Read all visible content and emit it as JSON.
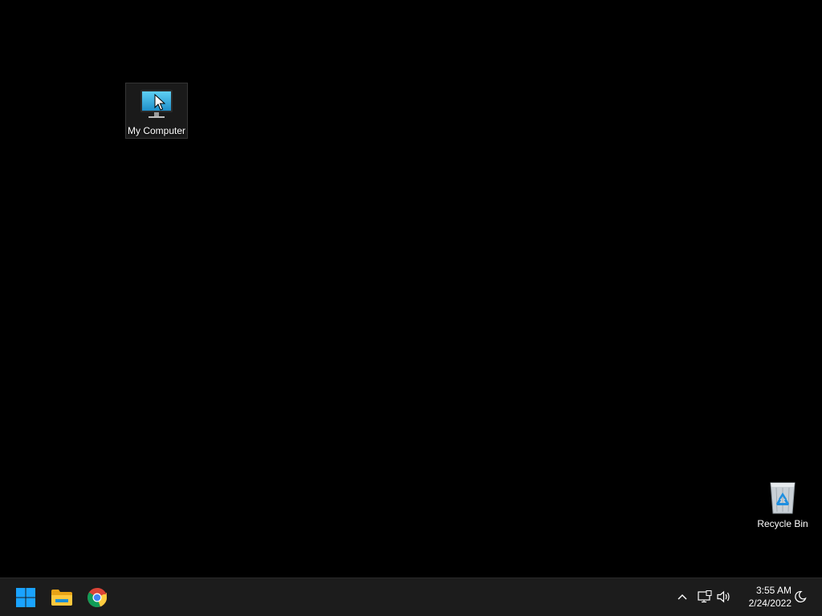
{
  "desktop": {
    "icons": [
      {
        "label": "My Computer",
        "icon": "monitor-icon",
        "selected": true
      },
      {
        "label": "Recycle Bin",
        "icon": "recycle-bin-icon",
        "selected": false
      }
    ]
  },
  "taskbar": {
    "pinned": [
      {
        "name": "Start",
        "icon": "windows-logo-icon"
      },
      {
        "name": "File Explorer",
        "icon": "folder-icon"
      },
      {
        "name": "Google Chrome",
        "icon": "chrome-icon"
      }
    ],
    "tray": {
      "icons": [
        "chevron-up-icon",
        "network-icon",
        "volume-icon",
        "focus-assist-icon"
      ],
      "time": "3:55 AM",
      "date": "2/24/2022"
    }
  },
  "colors": {
    "desktop_bg": "#000000",
    "taskbar_bg": "#1c1c1c",
    "windows_blue": "#1aa3ff",
    "monitor_screen": "#2ea9e0"
  }
}
